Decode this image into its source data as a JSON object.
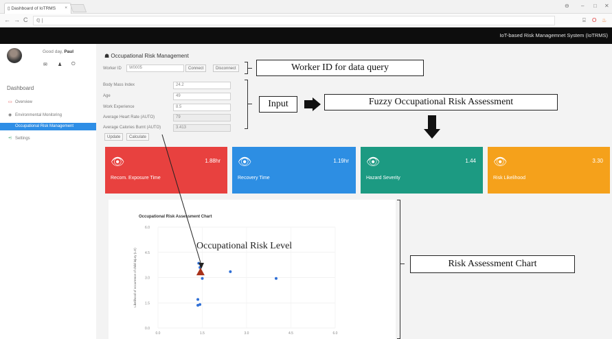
{
  "browser": {
    "tab_title": "Dashboard of IoTRMS",
    "tab_close": "×",
    "address": "ℚ |",
    "nav_back": "←",
    "nav_forward": "→",
    "nav_reload": "C",
    "win_user": "⊖",
    "win_min": "–",
    "win_max": "□",
    "win_close": "✕"
  },
  "header": {
    "app_title": "IoT-based Risk Managemnet System (IoTRMS)"
  },
  "user": {
    "greeting": "Good day,",
    "name": "Paul",
    "icon_mail": "✉",
    "icon_user": "♟",
    "icon_power": "⏻"
  },
  "sidebar": {
    "title": "Dashboard",
    "items": [
      {
        "icon": "▭",
        "label": "Overview"
      },
      {
        "icon": "◉",
        "label": "Environmental Monitoring"
      },
      {
        "icon": "",
        "label": "Occupational Risk Management"
      },
      {
        "icon": "⩤",
        "label": "Settings"
      }
    ]
  },
  "page": {
    "title": "Occupational Risk Management",
    "title_icon": "☗",
    "worker_label": "Worker ID",
    "worker_value": "W0005",
    "connect": "Connect",
    "disconnect": "Disconnect",
    "fields": [
      {
        "label": "Body Mass Index",
        "value": "24.2"
      },
      {
        "label": "Age",
        "value": "49"
      },
      {
        "label": "Work Experience",
        "value": "8.5"
      },
      {
        "label": "Average Heart Rate (AUTO)",
        "value": "79"
      },
      {
        "label": "Average Calories Burnt (AUTO)",
        "value": "3.413"
      }
    ],
    "update": "Update",
    "calculate": "Calculate"
  },
  "annotations": {
    "worker_id": "Worker ID for data query",
    "input": "Input",
    "fuzzy": "Fuzzy Occupational Risk Assessment",
    "risk_level": "Occupational Risk Level",
    "risk_chart": "Risk Assessment Chart"
  },
  "tiles": [
    {
      "value": "1.88hr",
      "label": "Recom. Exposure Time",
      "color": "#e8413f"
    },
    {
      "value": "1.19hr",
      "label": "Recovery Time",
      "color": "#2d8ee3"
    },
    {
      "value": "1.44",
      "label": "Hazard Severity",
      "color": "#1c9a82"
    },
    {
      "value": "3.30",
      "label": "Risk Likelihood",
      "color": "#f5a11b"
    }
  ],
  "chart_data": {
    "type": "scatter",
    "title": "Occupational Risk Assessment Chart",
    "xlabel": "",
    "ylabel": "Likelihood of occurrence of child injury (LO)",
    "xlim": [
      0,
      6
    ],
    "ylim": [
      0,
      6
    ],
    "xticks": [
      "0.0",
      "1.5",
      "3.0",
      "4.5",
      "6.0"
    ],
    "yticks": [
      "0.0",
      "1.5",
      "3.0",
      "4.5",
      "6.0"
    ],
    "points": [
      {
        "x": 1.38,
        "y": 3.85
      },
      {
        "x": 1.42,
        "y": 3.6
      },
      {
        "x": 1.5,
        "y": 2.95
      },
      {
        "x": 2.45,
        "y": 3.35
      },
      {
        "x": 4.0,
        "y": 2.95
      },
      {
        "x": 1.35,
        "y": 1.7
      },
      {
        "x": 1.35,
        "y": 1.35
      },
      {
        "x": 1.42,
        "y": 1.4
      }
    ],
    "highlight": {
      "x": 1.44,
      "y": 3.3,
      "color": "#a8321a"
    },
    "point_color": "#2f6fd6"
  }
}
